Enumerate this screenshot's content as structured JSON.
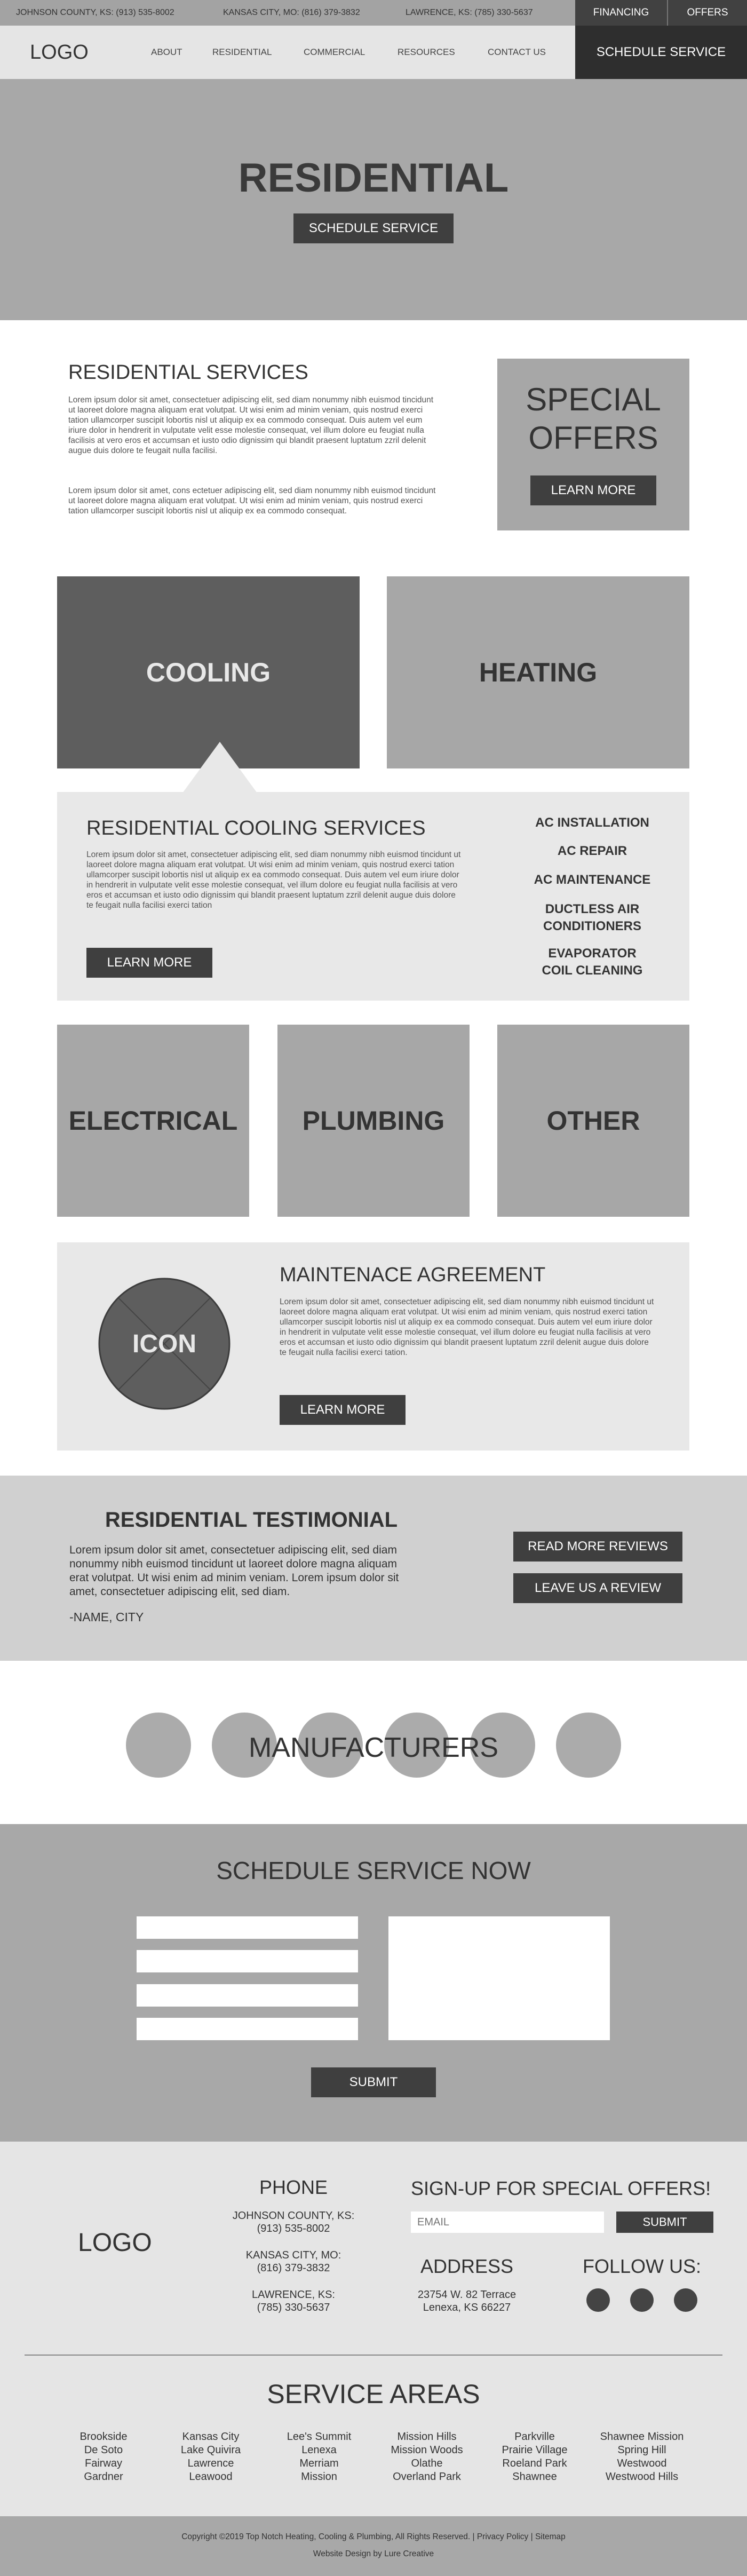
{
  "topbar": {
    "locations": [
      "JOHNSON COUNTY, KS: (913) 535-8002",
      "KANSAS CITY, MO: (816) 379-3832",
      "LAWRENCE, KS: (785) 330-5637"
    ],
    "financing": "FINANCING",
    "offers": "OFFERS"
  },
  "header": {
    "logo": "LOGO",
    "nav": [
      "ABOUT",
      "RESIDENTIAL",
      "COMMERCIAL",
      "RESOURCES",
      "CONTACT US"
    ],
    "schedule": "SCHEDULE SERVICE"
  },
  "hero": {
    "title": "RESIDENTIAL",
    "button": "SCHEDULE SERVICE"
  },
  "intro": {
    "title": "RESIDENTIAL SERVICES",
    "para1": "Lorem ipsum dolor sit amet, consectetuer adipiscing elit, sed diam nonummy nibh euismod tincidunt ut laoreet dolore magna aliquam erat volutpat. Ut wisi enim ad minim veniam, quis nostrud exerci tation ullamcorper suscipit lobortis nisl ut aliquip ex ea commodo consequat. Duis autem vel eum iriure dolor in hendrerit in vulputate velit esse molestie consequat, vel illum dolore eu feugiat nulla facilisis at vero eros et accumsan et iusto odio dignissim qui blandit praesent luptatum zzril delenit augue duis dolore te feugait nulla facilisi.",
    "para2": "Lorem ipsum dolor sit amet, cons ectetuer adipiscing elit, sed diam nonummy nibh euismod tincidunt ut laoreet dolore magna aliquam erat volutpat. Ut wisi enim ad minim veniam, quis nostrud exerci tation ullamcorper suscipit lobortis nisl ut aliquip ex ea commodo consequat."
  },
  "special": {
    "line1": "SPECIAL",
    "line2": "OFFERS",
    "button": "LEARN MORE"
  },
  "services_row1": {
    "cooling": "COOLING",
    "heating": "HEATING"
  },
  "cooling_panel": {
    "title": "RESIDENTIAL COOLING SERVICES",
    "text": "Lorem ipsum dolor sit amet, consectetuer adipiscing elit, sed diam nonummy nibh euismod tincidunt ut laoreet dolore magna aliquam erat volutpat. Ut wisi enim ad minim veniam, quis nostrud exerci tation ullamcorper suscipit lobortis nisl ut aliquip ex ea commodo consequat. Duis autem vel eum iriure dolor in hendrerit in vulputate velit esse molestie consequat, vel illum dolore eu feugiat nulla facilisis at vero eros et accumsan et iusto odio dignissim qui blandit praesent luptatum zzril delenit augue duis dolore te feugait nulla facilisi exerci tation",
    "button": "LEARN MORE",
    "links": [
      "AC INSTALLATION",
      "AC REPAIR",
      "AC MAINTENANCE",
      "DUCTLESS AIR CONDITIONERS",
      "EVAPORATOR COIL CLEANING"
    ]
  },
  "services_row2": {
    "electrical": "ELECTRICAL",
    "plumbing": "PLUMBING",
    "other": "OTHER"
  },
  "maintenance": {
    "icon": "ICON",
    "title": "MAINTENACE AGREEMENT",
    "text": "Lorem ipsum dolor sit amet, consectetuer adipiscing elit, sed diam nonummy nibh euismod tincidunt ut laoreet dolore magna aliquam erat volutpat. Ut wisi enim ad minim veniam, quis nostrud exerci tation ullamcorper suscipit lobortis nisl ut aliquip ex ea commodo consequat. Duis autem vel eum iriure dolor in hendrerit in vulputate velit esse molestie consequat, vel illum dolore eu feugiat nulla facilisis at vero eros et accumsan et iusto odio dignissim qui blandit praesent luptatum zzril delenit augue duis dolore te feugait nulla facilisi exerci tation.",
    "button": "LEARN MORE"
  },
  "testimonial": {
    "title": "RESIDENTIAL TESTIMONIAL",
    "text": "Lorem ipsum dolor sit amet, consectetuer adipiscing elit, sed diam nonummy nibh euismod tincidunt ut laoreet dolore magna aliquam erat volutpat. Ut wisi enim ad minim veniam. Lorem ipsum dolor sit amet, consectetuer adipiscing elit, sed diam.",
    "name": "-NAME, CITY",
    "reviews_button": "READ MORE REVIEWS",
    "leave_button": "LEAVE US A REVIEW"
  },
  "manufacturers": {
    "title": "MANUFACTURERS"
  },
  "schedule": {
    "title": "SCHEDULE SERVICE NOW",
    "submit": "SUBMIT"
  },
  "footer": {
    "logo": "LOGO",
    "phone_title": "PHONE",
    "phones": [
      {
        "city": "JOHNSON COUNTY, KS:",
        "number": "(913) 535-8002"
      },
      {
        "city": "KANSAS CITY, MO:",
        "number": "(816) 379-3832"
      },
      {
        "city": "LAWRENCE, KS:",
        "number": "(785) 330-5637"
      }
    ],
    "signup_title": "SIGN-UP FOR SPECIAL OFFERS!",
    "email_placeholder": "EMAIL",
    "signup_submit": "SUBMIT",
    "address_title": "ADDRESS",
    "address1": "23754 W. 82 Terrace",
    "address2": "Lenexa, KS 66227",
    "follow_title": "FOLLOW US:",
    "service_areas_title": "SERVICE AREAS",
    "areas": [
      [
        "Brookside",
        "De Soto",
        "Fairway",
        "Gardner"
      ],
      [
        "Kansas City",
        "Lake Quivira",
        "Lawrence",
        "Leawood"
      ],
      [
        "Lee's Summit",
        "Lenexa",
        "Merriam",
        "Mission"
      ],
      [
        "Mission Hills",
        "Mission Woods",
        "Olathe",
        "Overland Park"
      ],
      [
        "Parkville",
        "Prairie Village",
        "Roeland Park",
        "Shawnee"
      ],
      [
        "Shawnee Mission",
        "Spring Hill",
        "Westwood",
        "Westwood Hills"
      ]
    ],
    "copyright": "Copyright ©2019 Top Notch Heating, Cooling & Plumbing, All Rights Reserved. | Privacy Policy | Sitemap",
    "credit": "Website Design by Lure Creative"
  },
  "colors": {
    "dark": "#3f3f3f",
    "mid_gray": "#a7a7a7",
    "light_gray": "#e8e8e8",
    "cooling_box": "#5e5e5e"
  }
}
